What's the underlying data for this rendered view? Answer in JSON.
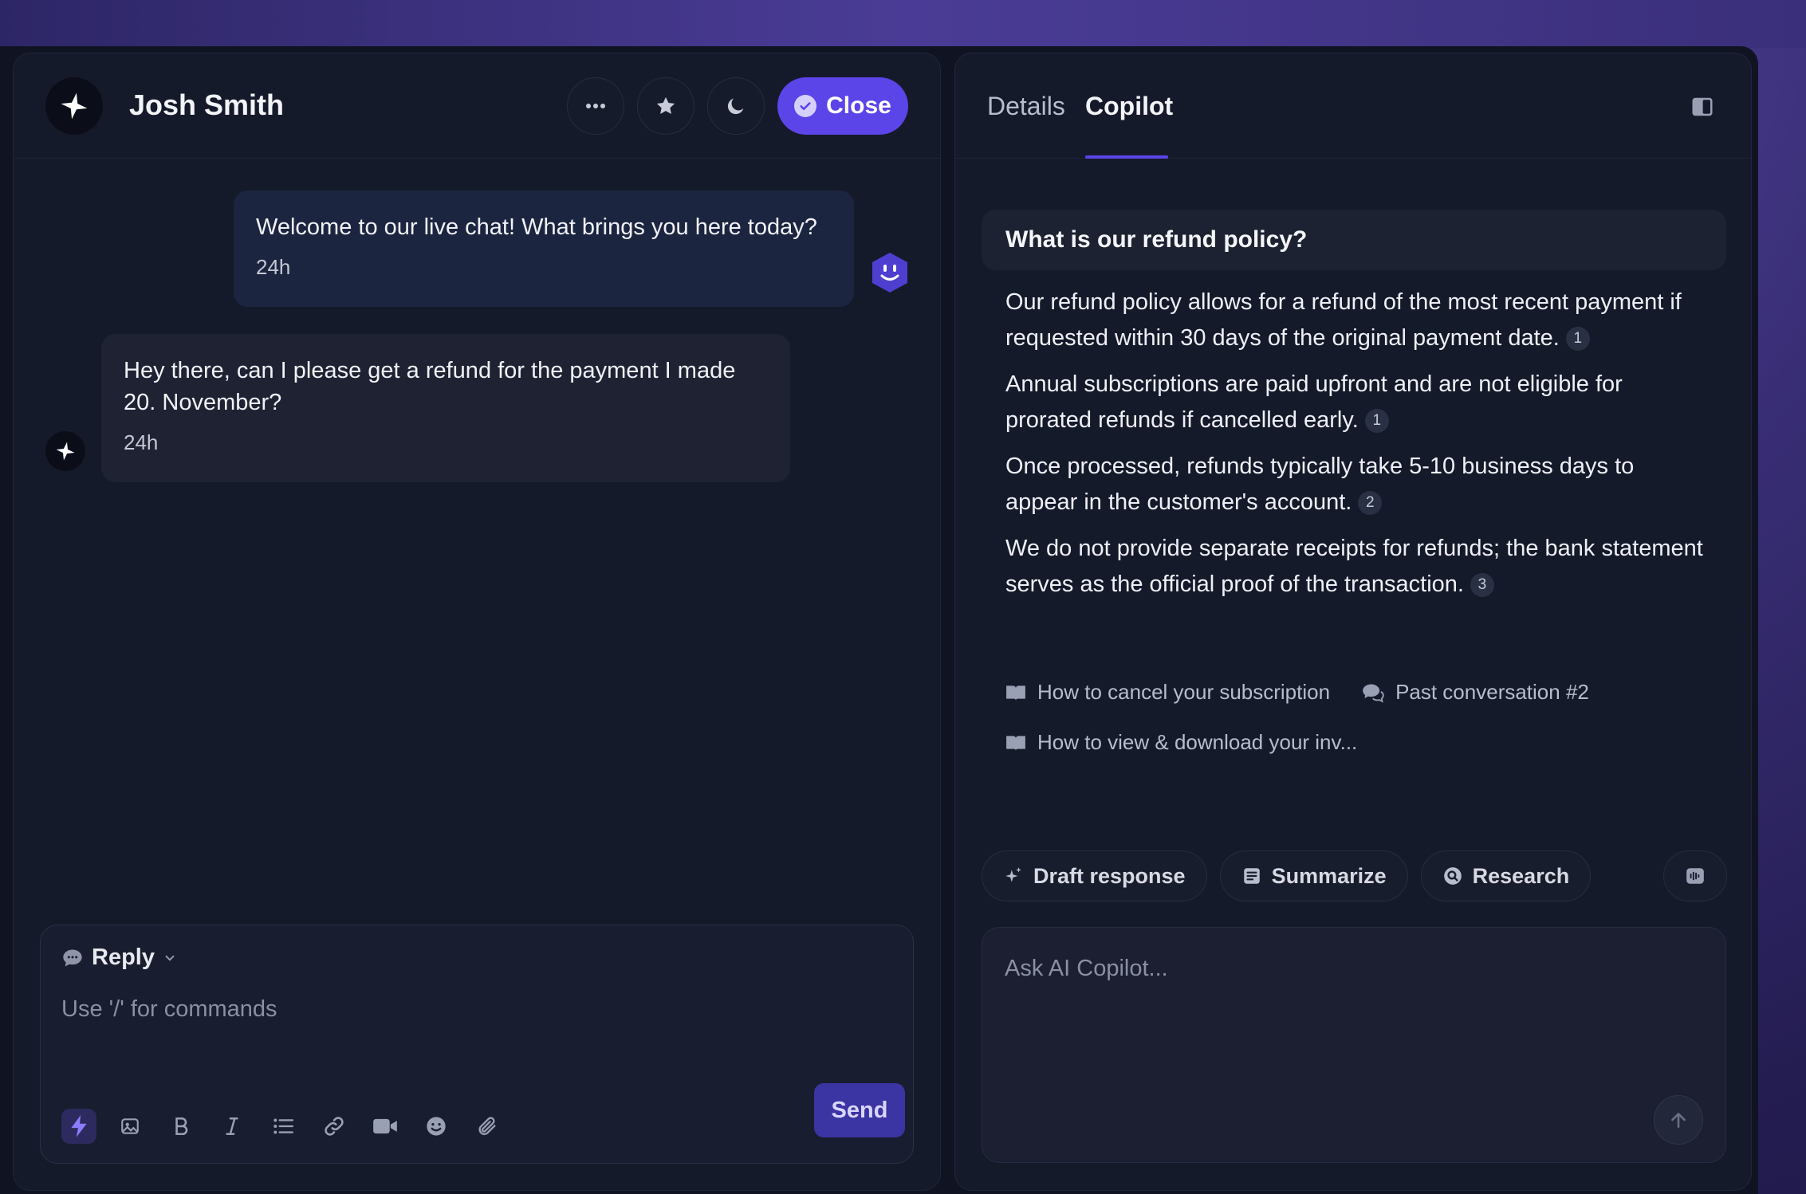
{
  "chat": {
    "contact_name": "Josh Smith",
    "header_buttons": {
      "more": "more-icon",
      "star": "star-icon",
      "snooze": "moon-icon",
      "close_label": "Close"
    },
    "messages": [
      {
        "direction": "outgoing",
        "text": "Welcome to our live chat! What brings you here today?",
        "time": "24h"
      },
      {
        "direction": "incoming",
        "text": "Hey there, can I please get a refund for the payment I made 20. November?",
        "time": "24h"
      }
    ],
    "composer": {
      "mode_label": "Reply",
      "placeholder": "Use '/' for commands",
      "send_label": "Send",
      "tools": [
        "lightning-icon",
        "image-icon",
        "bold-icon",
        "italic-icon",
        "list-icon",
        "link-icon",
        "video-icon",
        "emoji-icon",
        "attachment-icon"
      ]
    }
  },
  "copilot": {
    "tabs": [
      {
        "label": "Details",
        "active": false
      },
      {
        "label": "Copilot",
        "active": true
      }
    ],
    "question": "What is our refund policy?",
    "answer": [
      {
        "text": "Our refund policy allows for a refund of the most recent payment if requested within 30 days of the original payment date.",
        "citation": "1"
      },
      {
        "text": "Annual subscriptions are paid upfront and are not eligible for prorated refunds if cancelled early.",
        "citation": "1"
      },
      {
        "text": "Once processed, refunds typically take 5-10 business days to appear in the customer's account.",
        "citation": "2"
      },
      {
        "text": "We do not provide separate receipts for refunds; the bank statement serves as the official proof of the transaction.",
        "citation": "3"
      }
    ],
    "sources": [
      {
        "icon": "book-icon",
        "label": "How to cancel your subscription"
      },
      {
        "icon": "chat-bubbles-icon",
        "label": "Past conversation #2"
      },
      {
        "icon": "book-icon",
        "label": "How to view & download your inv..."
      }
    ],
    "actions": [
      {
        "icon": "sparkle-icon",
        "label": "Draft response"
      },
      {
        "icon": "document-icon",
        "label": "Summarize"
      },
      {
        "icon": "search-icon",
        "label": "Research"
      }
    ],
    "ask_placeholder": "Ask AI Copilot..."
  },
  "colors": {
    "accent": "#5b45e8",
    "panel_bg": "#151a2b",
    "app_bg": "#101422"
  }
}
